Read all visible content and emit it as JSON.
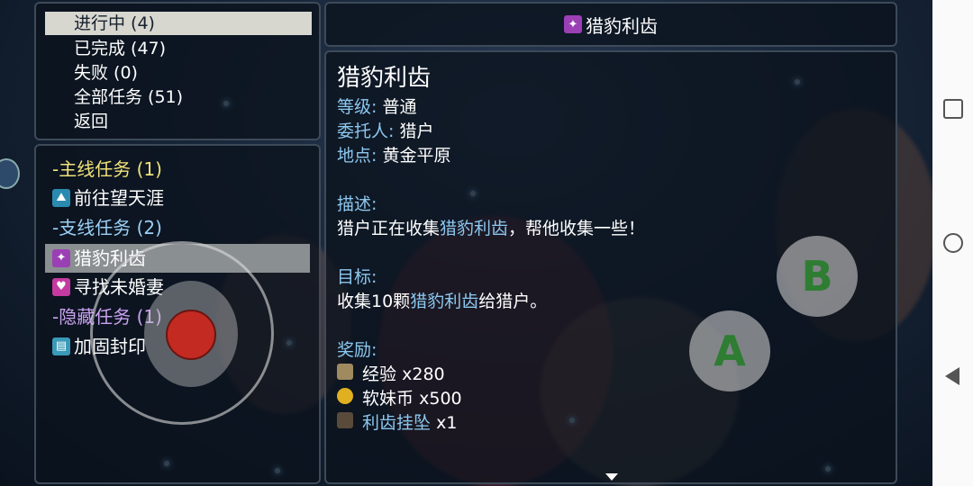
{
  "tabs": [
    {
      "label": "进行中 (4)",
      "selected": true
    },
    {
      "label": "已完成 (47)",
      "selected": false
    },
    {
      "label": "失败 (0)",
      "selected": false
    },
    {
      "label": "全部任务 (51)",
      "selected": false
    },
    {
      "label": "返回",
      "selected": false
    }
  ],
  "quest_list": {
    "main_category": "-主线任务 (1)",
    "main_quest": "前往望天涯",
    "side_category": "-支线任务 (2)",
    "side_quest_1": "猎豹利齿",
    "side_quest_2": "寻找未婚妻",
    "hidden_category": "-隐藏任务 (1)",
    "hidden_quest": "加固封印"
  },
  "header": {
    "title": "猎豹利齿"
  },
  "detail": {
    "name": "猎豹利齿",
    "level_label": "等级:",
    "level_value": "普通",
    "client_label": "委托人:",
    "client_value": "猎户",
    "location_label": "地点:",
    "location_value": "黄金平原",
    "desc_label": "描述:",
    "desc_pre": "猎户正在收集",
    "desc_hl": "猎豹利齿",
    "desc_post": "，帮他收集一些！",
    "goal_label": "目标:",
    "goal_pre": "收集10颗",
    "goal_hl": "猎豹利齿",
    "goal_post": "给猎户。",
    "reward_label": "奖励:",
    "rewards": [
      {
        "name": "经验",
        "amount": "x280",
        "icon": "scroll-icon"
      },
      {
        "name": "软妹币",
        "amount": "x500",
        "icon": "coin-icon"
      },
      {
        "name": "利齿挂坠",
        "amount": "x1",
        "icon": "pendant-icon"
      }
    ]
  },
  "controls": {
    "button_a": "A",
    "button_b": "B"
  }
}
